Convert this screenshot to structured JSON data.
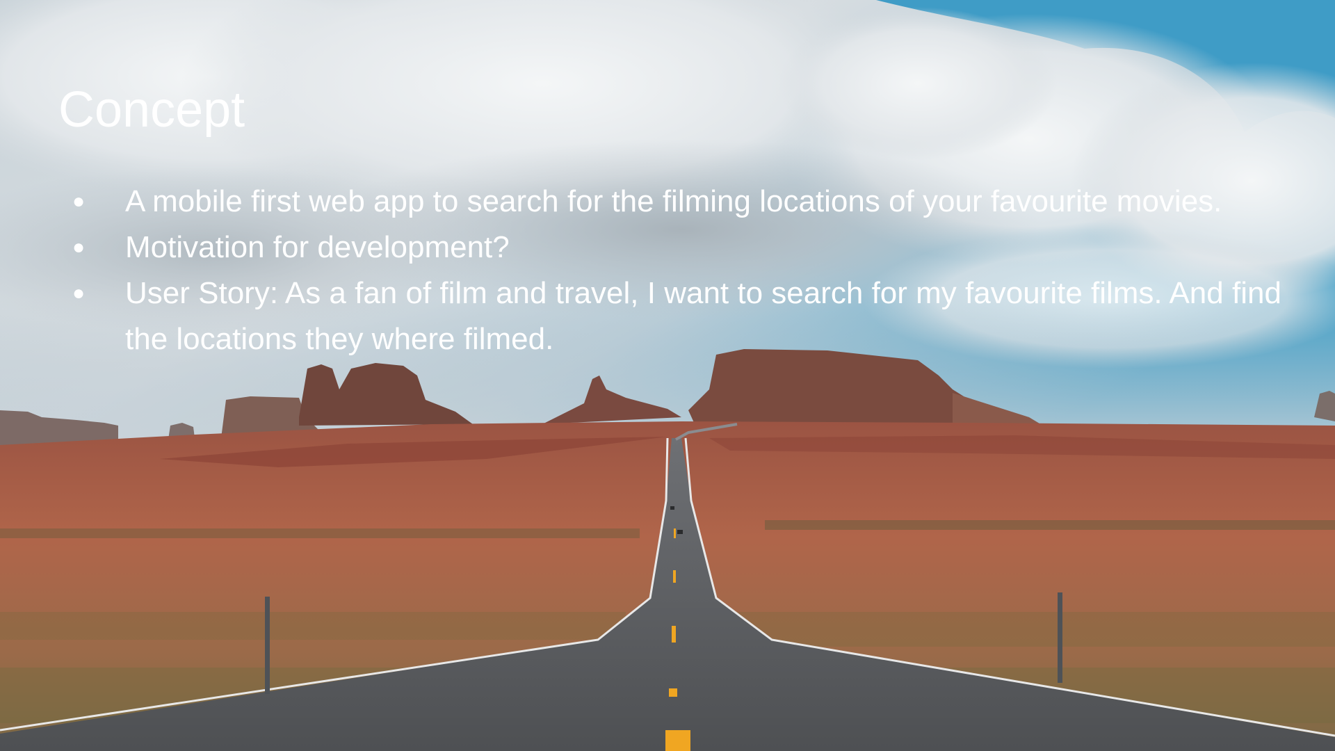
{
  "slide": {
    "title": "Concept",
    "bullets": [
      {
        "text": "A mobile first web app to search for the filming locations of your favourite movies."
      },
      {
        "text": "Motivation for development?"
      },
      {
        "text": "User Story: As a fan of film and travel, I want to search for my favourite films. And find the locations they where filmed."
      }
    ]
  },
  "colors": {
    "sky_top": "#4aa3c9",
    "cloud": "#e9edf0",
    "butte": "#8a4c3e",
    "desert": "#b0654a",
    "road": "#55575a",
    "center_line": "#f0a622",
    "text": "#ffffff"
  }
}
